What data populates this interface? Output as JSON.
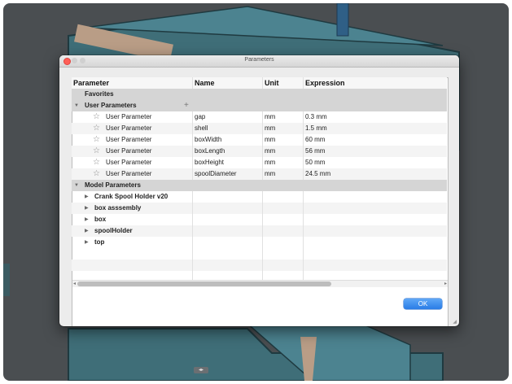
{
  "window": {
    "title": "Parameters"
  },
  "table": {
    "columns": [
      "Parameter",
      "Name",
      "Unit",
      "Expression"
    ],
    "favorites_label": "Favorites",
    "user_group_label": "User Parameters",
    "user_rows": [
      {
        "parameter": "User Parameter",
        "name": "gap",
        "unit": "mm",
        "expression": "0.3 mm"
      },
      {
        "parameter": "User Parameter",
        "name": "shell",
        "unit": "mm",
        "expression": "1.5 mm"
      },
      {
        "parameter": "User Parameter",
        "name": "boxWidth",
        "unit": "mm",
        "expression": "60 mm"
      },
      {
        "parameter": "User Parameter",
        "name": "boxLength",
        "unit": "mm",
        "expression": "56 mm"
      },
      {
        "parameter": "User Parameter",
        "name": "boxHeight",
        "unit": "mm",
        "expression": "50 mm"
      },
      {
        "parameter": "User Parameter",
        "name": "spoolDiameter",
        "unit": "mm",
        "expression": "24.5 mm"
      }
    ],
    "model_group_label": "Model Parameters",
    "model_rows": [
      {
        "label": "Crank Spool Holder v20"
      },
      {
        "label": "box asssembly"
      },
      {
        "label": "box"
      },
      {
        "label": "spoolHolder"
      },
      {
        "label": "top"
      }
    ]
  },
  "buttons": {
    "ok_label": "OK"
  },
  "icons": {
    "star": "star-outline-icon",
    "expand": "disclosure-triangle-icon",
    "add": "plus-icon"
  },
  "colors": {
    "viewport_bg": "#4a4e51",
    "model_teal": "#3f6e78",
    "ok_blue": "#2a7ce6",
    "group_row": "#d5d5d5"
  }
}
